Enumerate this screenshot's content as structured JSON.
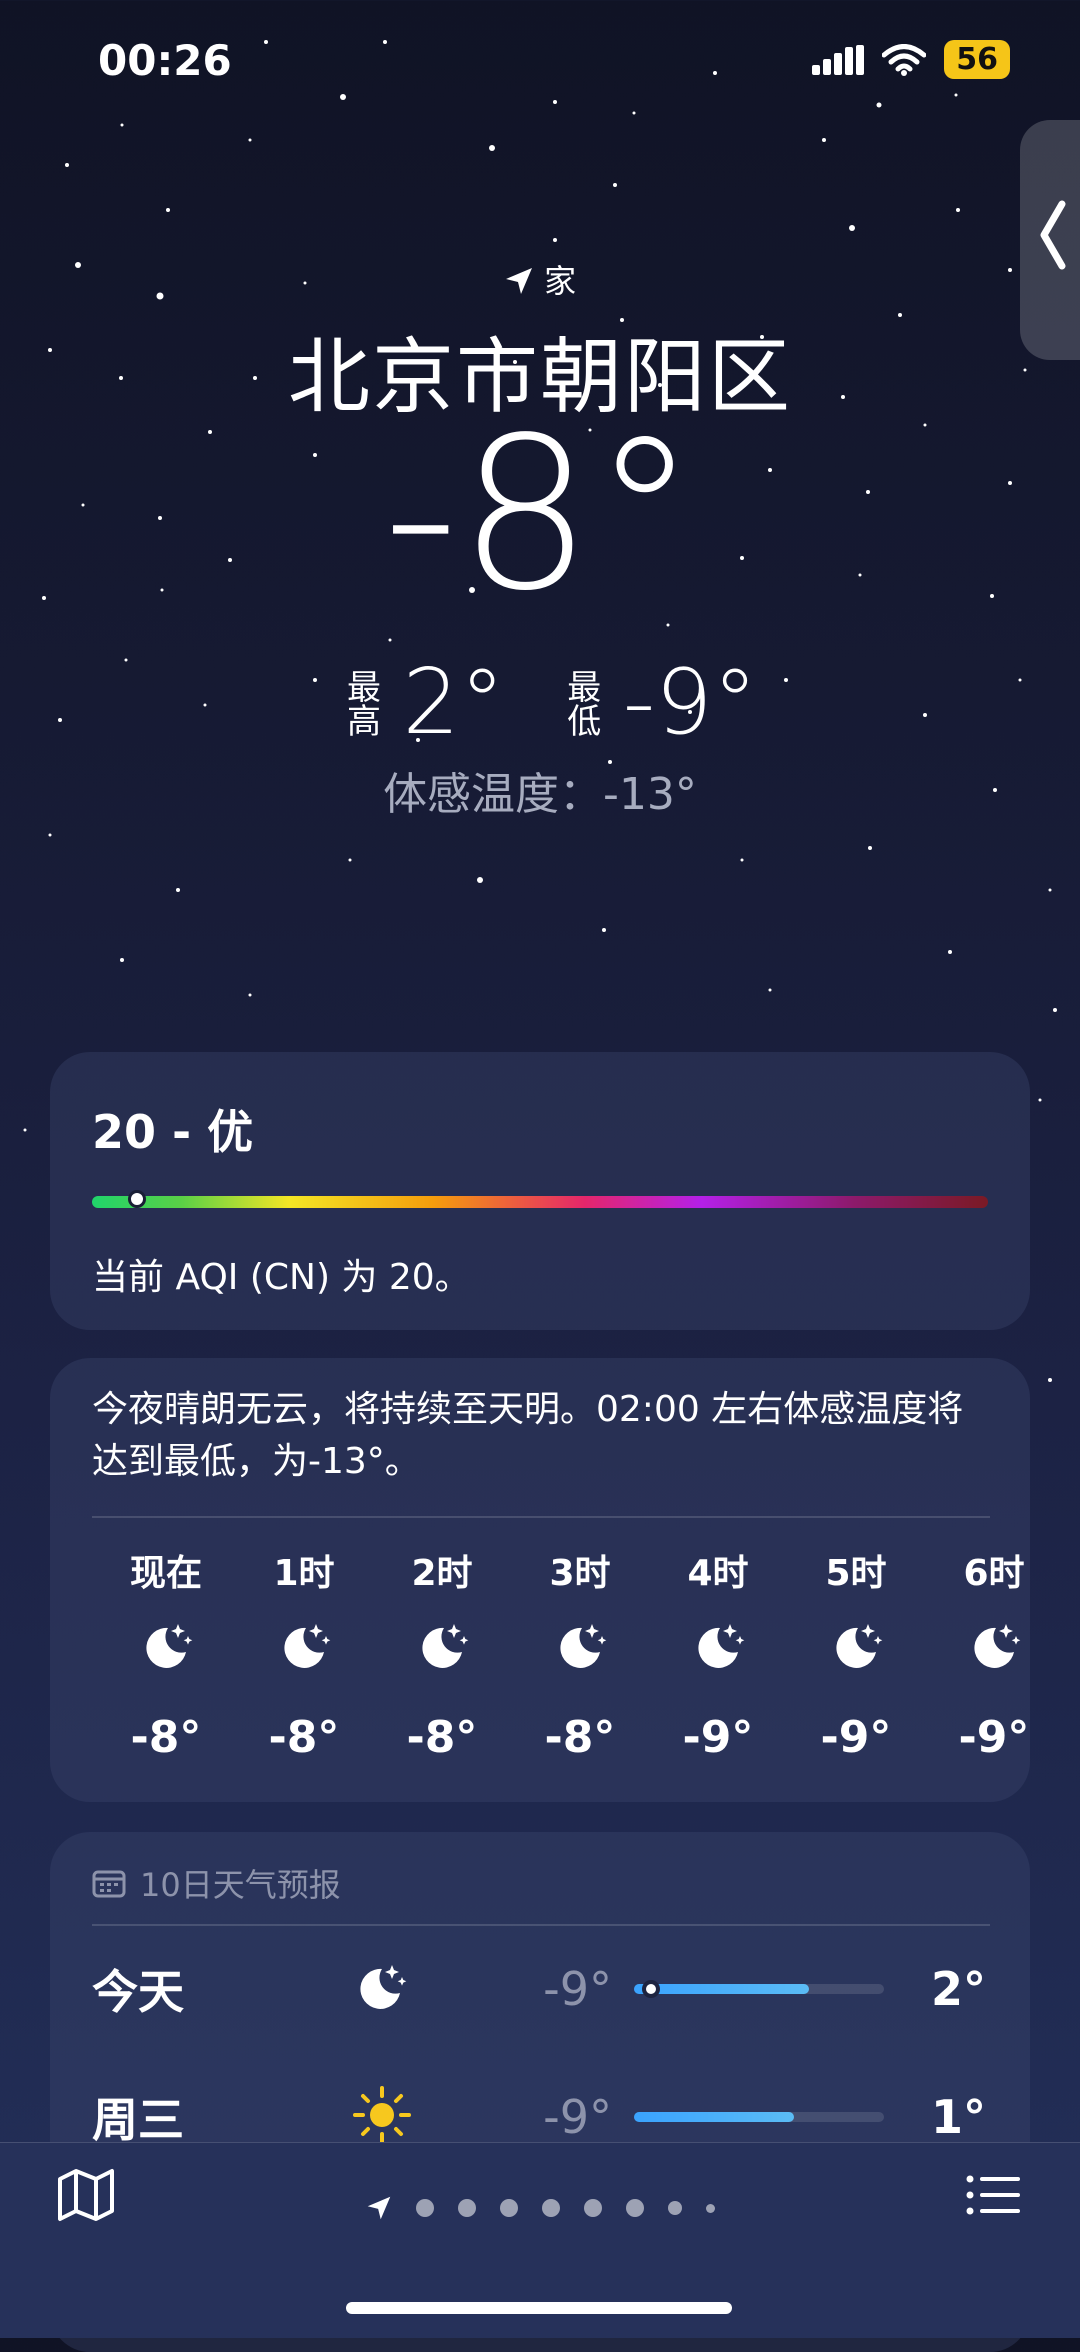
{
  "status": {
    "time": "00:26",
    "battery": "56"
  },
  "header": {
    "location_label": "家",
    "city": "北京市朝阳区",
    "current_temp": "-8°",
    "high_label": "最高",
    "high_value": "2°",
    "low_label": "最低",
    "low_value": "-9°",
    "feels_like": "体感温度：-13°"
  },
  "aqi": {
    "title": "20 - 优",
    "level_fraction": 0.04,
    "description": "当前 AQI (CN) 为 20。"
  },
  "hourly": {
    "description": "今夜晴朗无云，将持续至天明。02:00 左右体感温度将达到最低，为-13°。",
    "items": [
      {
        "label": "现在",
        "icon": "moon-stars-icon",
        "temp": "-8°"
      },
      {
        "label": "1时",
        "icon": "moon-stars-icon",
        "temp": "-8°"
      },
      {
        "label": "2时",
        "icon": "moon-stars-icon",
        "temp": "-8°"
      },
      {
        "label": "3时",
        "icon": "moon-stars-icon",
        "temp": "-8°"
      },
      {
        "label": "4时",
        "icon": "moon-stars-icon",
        "temp": "-9°"
      },
      {
        "label": "5时",
        "icon": "moon-stars-icon",
        "temp": "-9°"
      },
      {
        "label": "6时",
        "icon": "moon-stars-icon",
        "temp": "-9°"
      }
    ]
  },
  "forecast": {
    "header": "10日天气预报",
    "days": [
      {
        "day": "今天",
        "icon": "moon-stars-icon",
        "low": "-9°",
        "high": "2°",
        "range_start": 0.0,
        "range_end": 0.7,
        "current_marker": 0.05
      },
      {
        "day": "周三",
        "icon": "sun-icon",
        "low": "-9°",
        "high": "1°",
        "range_start": 0.0,
        "range_end": 0.64
      }
    ]
  },
  "bottom": {
    "page_count": 9
  },
  "colors": {
    "battery": "#f5c518",
    "bar_blue": "#3aa3ff",
    "background": "#161a33"
  }
}
